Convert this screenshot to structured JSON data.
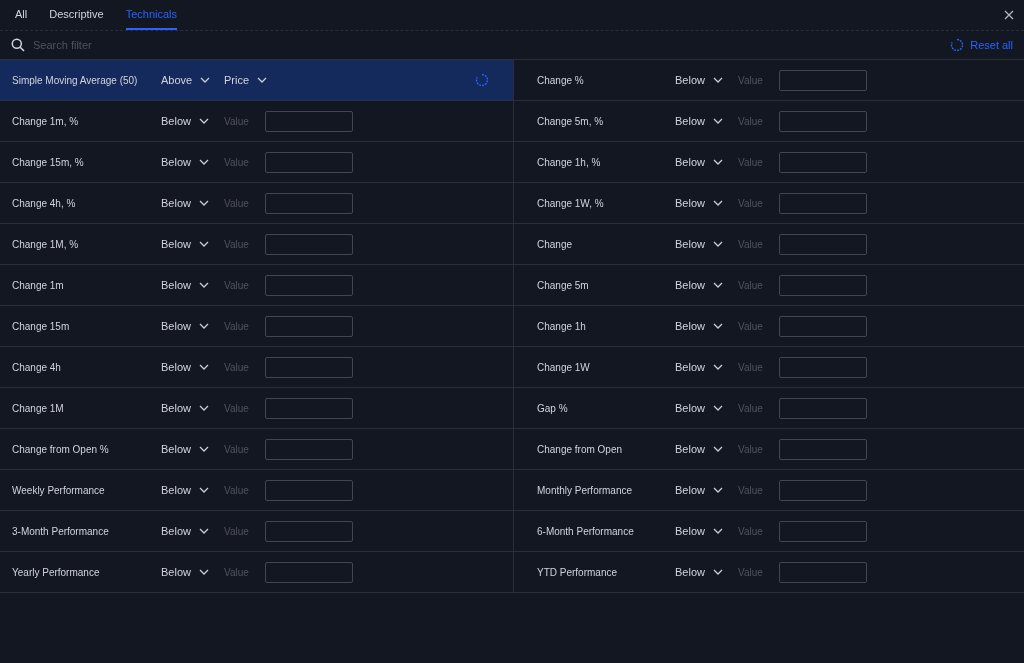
{
  "tabs": [
    {
      "label": "All",
      "selected": false
    },
    {
      "label": "Descriptive",
      "selected": false
    },
    {
      "label": "Technicals",
      "selected": true
    }
  ],
  "search": {
    "placeholder": "Search filter"
  },
  "reset": {
    "label": "Reset all"
  },
  "filters": [
    {
      "kind": "select",
      "label": "Simple Moving Average (50)",
      "condition": "Above",
      "target": "Price",
      "active": true
    },
    {
      "kind": "value",
      "label": "Change %",
      "condition": "Below",
      "value_label": "Value",
      "active": false
    },
    {
      "kind": "value",
      "label": "Change 1m, %",
      "condition": "Below",
      "value_label": "Value",
      "active": false
    },
    {
      "kind": "value",
      "label": "Change 5m, %",
      "condition": "Below",
      "value_label": "Value",
      "active": false
    },
    {
      "kind": "value",
      "label": "Change 15m, %",
      "condition": "Below",
      "value_label": "Value",
      "active": false
    },
    {
      "kind": "value",
      "label": "Change 1h, %",
      "condition": "Below",
      "value_label": "Value",
      "active": false
    },
    {
      "kind": "value",
      "label": "Change 4h, %",
      "condition": "Below",
      "value_label": "Value",
      "active": false
    },
    {
      "kind": "value",
      "label": "Change 1W, %",
      "condition": "Below",
      "value_label": "Value",
      "active": false
    },
    {
      "kind": "value",
      "label": "Change 1M, %",
      "condition": "Below",
      "value_label": "Value",
      "active": false
    },
    {
      "kind": "value",
      "label": "Change",
      "condition": "Below",
      "value_label": "Value",
      "active": false
    },
    {
      "kind": "value",
      "label": "Change 1m",
      "condition": "Below",
      "value_label": "Value",
      "active": false
    },
    {
      "kind": "value",
      "label": "Change 5m",
      "condition": "Below",
      "value_label": "Value",
      "active": false
    },
    {
      "kind": "value",
      "label": "Change 15m",
      "condition": "Below",
      "value_label": "Value",
      "active": false
    },
    {
      "kind": "value",
      "label": "Change 1h",
      "condition": "Below",
      "value_label": "Value",
      "active": false
    },
    {
      "kind": "value",
      "label": "Change 4h",
      "condition": "Below",
      "value_label": "Value",
      "active": false
    },
    {
      "kind": "value",
      "label": "Change 1W",
      "condition": "Below",
      "value_label": "Value",
      "active": false
    },
    {
      "kind": "value",
      "label": "Change 1M",
      "condition": "Below",
      "value_label": "Value",
      "active": false
    },
    {
      "kind": "value",
      "label": "Gap %",
      "condition": "Below",
      "value_label": "Value",
      "active": false
    },
    {
      "kind": "value",
      "label": "Change from Open %",
      "condition": "Below",
      "value_label": "Value",
      "active": false
    },
    {
      "kind": "value",
      "label": "Change from Open",
      "condition": "Below",
      "value_label": "Value",
      "active": false
    },
    {
      "kind": "value",
      "label": "Weekly Performance",
      "condition": "Below",
      "value_label": "Value",
      "active": false
    },
    {
      "kind": "value",
      "label": "Monthly Performance",
      "condition": "Below",
      "value_label": "Value",
      "active": false
    },
    {
      "kind": "value",
      "label": "3-Month Performance",
      "condition": "Below",
      "value_label": "Value",
      "active": false
    },
    {
      "kind": "value",
      "label": "6-Month Performance",
      "condition": "Below",
      "value_label": "Value",
      "active": false
    },
    {
      "kind": "value",
      "label": "Yearly Performance",
      "condition": "Below",
      "value_label": "Value",
      "active": false
    },
    {
      "kind": "value",
      "label": "YTD Performance",
      "condition": "Below",
      "value_label": "Value",
      "active": false
    }
  ]
}
